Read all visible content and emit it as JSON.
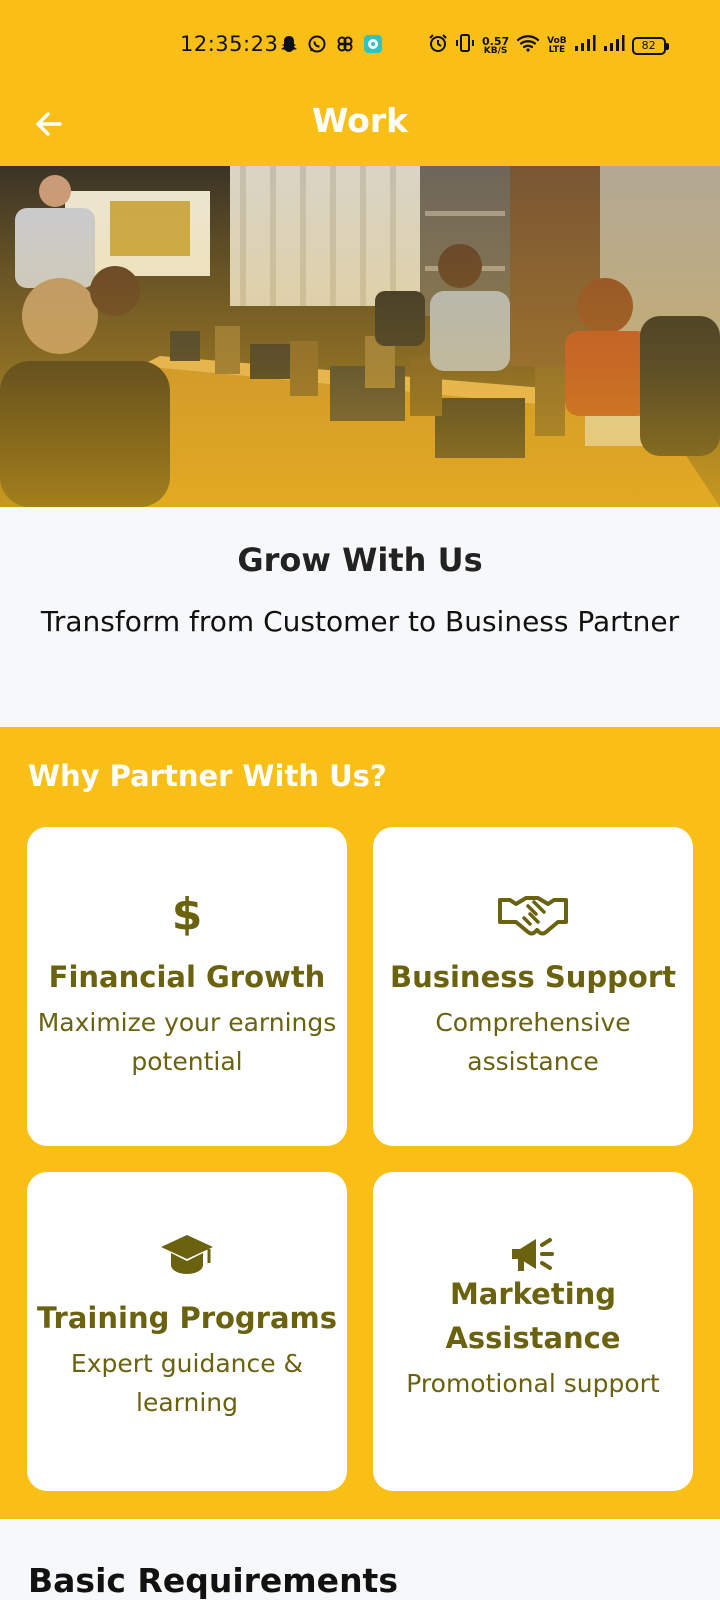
{
  "status_bar": {
    "time": "12:35:23",
    "net_speed_value": "0.57",
    "net_speed_unit": "KB/S",
    "volte_top": "VoB",
    "volte_bottom": "LTE",
    "battery": "82",
    "icons": [
      "snapchat-icon",
      "whatsapp-icon",
      "pinwheel-icon",
      "app-notification-icon",
      "alarm-icon",
      "vibrate-icon",
      "wifi-icon",
      "signal-icon",
      "signal-icon-2",
      "battery-icon"
    ]
  },
  "app_bar": {
    "title": "Work",
    "back_icon": "arrow-left-icon"
  },
  "hero": {
    "image": "meeting-room-photo"
  },
  "intro": {
    "title": "Grow With Us",
    "subtitle": "Transform from Customer to Business Partner"
  },
  "partner": {
    "heading": "Why Partner With Us?",
    "cards": [
      {
        "icon": "dollar-icon",
        "title": "Financial Growth",
        "desc": "Maximize your earnings potential"
      },
      {
        "icon": "handshake-icon",
        "title": "Business Support",
        "desc": "Comprehensive assistance"
      },
      {
        "icon": "graduation-cap-icon",
        "title": "Training Programs",
        "desc": "Expert guidance & learning"
      },
      {
        "icon": "megaphone-icon",
        "title": "Marketing Assistance",
        "desc": "Promotional support"
      }
    ]
  },
  "requirements": {
    "heading": "Basic Requirements"
  },
  "colors": {
    "primary": "#f9bf17",
    "card_text": "#6b620f",
    "background": "#f7f8fa"
  }
}
